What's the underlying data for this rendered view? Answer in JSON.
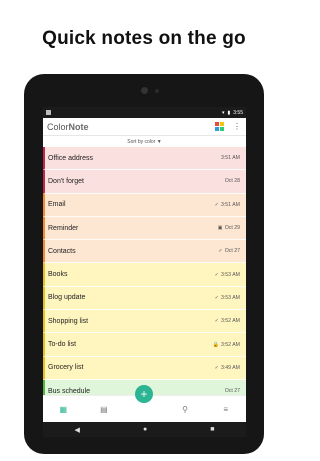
{
  "headline": "Quick notes on the go",
  "status": {
    "time": "3:55"
  },
  "app": {
    "title_part1": "Color",
    "title_part2": "Note"
  },
  "sort": {
    "label": "Sort by color",
    "caret": "▼"
  },
  "colors": {
    "red": "#fbe0e0",
    "red_edge": "#c0284a",
    "orange": "#fde6d2",
    "orange_edge": "#f08e2c",
    "yellow": "#fff6bf",
    "yellow_edge": "#e6c221",
    "green": "#e0f6da",
    "green_edge": "#53b93e",
    "fab": "#2bb592"
  },
  "notes": [
    {
      "title": "Office address",
      "time": "3:51 AM",
      "icon": "",
      "color": "red"
    },
    {
      "title": "Don't forget",
      "time": "Oct 28",
      "icon": "",
      "color": "red"
    },
    {
      "title": "Email",
      "time": "3:51 AM",
      "icon": "✓",
      "color": "orange"
    },
    {
      "title": "Reminder",
      "time": "Oct 29",
      "icon": "▣",
      "color": "orange"
    },
    {
      "title": "Contacts",
      "time": "Oct 27",
      "icon": "✓",
      "color": "orange"
    },
    {
      "title": "Books",
      "time": "3:53 AM",
      "icon": "✓",
      "color": "yellow"
    },
    {
      "title": "Blog update",
      "time": "3:53 AM",
      "icon": "✓",
      "color": "yellow"
    },
    {
      "title": "Shopping list",
      "time": "3:52 AM",
      "icon": "✓",
      "color": "yellow"
    },
    {
      "title": "To-do list",
      "time": "3:52 AM",
      "icon": "🔒",
      "color": "yellow"
    },
    {
      "title": "Grocery list",
      "time": "3:49 AM",
      "icon": "✓",
      "color": "yellow"
    },
    {
      "title": "Bus schedule",
      "time": "Oct 27",
      "icon": "",
      "color": "green"
    }
  ],
  "nav": {
    "fab_label": "+"
  }
}
